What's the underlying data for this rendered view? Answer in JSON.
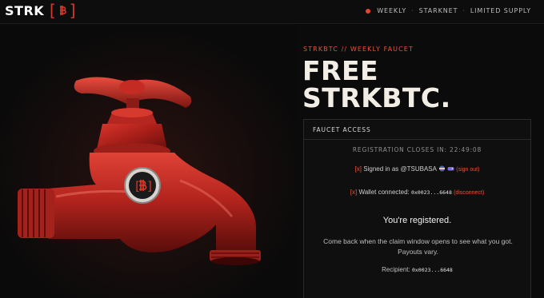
{
  "header": {
    "logo_text": "STRK",
    "nav": {
      "weekly": "WEEKLY",
      "separator": "·",
      "starknet": "STARKNET",
      "limited_supply": "LIMITED SUPPLY"
    }
  },
  "hero": {
    "badge_open": "[",
    "badge_close": "]"
  },
  "main": {
    "eyebrow": "STRKBTC // WEEKLY FAUCET",
    "title_line1": "FREE",
    "title_line2": "STRKBTC."
  },
  "faucet": {
    "header": "FAUCET ACCESS",
    "registration": "REGISTRATION CLOSES IN: 22:49:08",
    "signed_marker": "[x]",
    "signed_text": "Signed in as @TSUBASA",
    "sign_out": "(sign out)",
    "wallet_marker": "[x]",
    "wallet_text": "Wallet connected:",
    "wallet_address": "0x0023...6648",
    "disconnect": "(disconnect)",
    "registered": "You're registered.",
    "message": "Come back when the claim window opens to see what you got. Payouts vary.",
    "recipient_label": "Recipient:",
    "recipient_address": "0x0023...6648"
  },
  "colors": {
    "accent": "#e0563c",
    "background": "#0b0b0b",
    "faucet_red": "#b0201b"
  }
}
